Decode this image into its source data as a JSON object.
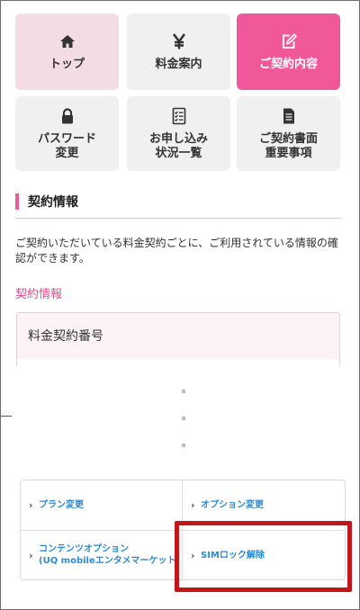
{
  "tiles": [
    {
      "label": "トップ",
      "icon": "home-icon",
      "state": "highlighted"
    },
    {
      "label": "料金案内",
      "icon": "yen-icon",
      "state": "normal"
    },
    {
      "label": "ご契約内容",
      "icon": "edit-icon",
      "state": "active"
    },
    {
      "label": "パスワード\n変更",
      "icon": "lock-icon",
      "state": "normal"
    },
    {
      "label": "お申し込み\n状況一覧",
      "icon": "checklist-icon",
      "state": "normal"
    },
    {
      "label": "ご契約書面\n重要事項",
      "icon": "document-icon",
      "state": "normal"
    }
  ],
  "section": {
    "title": "契約情報",
    "description": "ご契約いただいている料金契約ごとに、ご利用されている情報の確認ができます。",
    "sub_link": "契約情報",
    "box_label": "料金契約番号"
  },
  "links": [
    {
      "label": "プラン変更"
    },
    {
      "label": "オプション変更"
    },
    {
      "label": "コンテンツオプション\n(UQ mobileエンタメマーケット"
    },
    {
      "label": "SIMロック解除"
    }
  ],
  "colors": {
    "accent": "#f0589a",
    "link": "#2a8ad4",
    "highlight": "#c3161b"
  }
}
